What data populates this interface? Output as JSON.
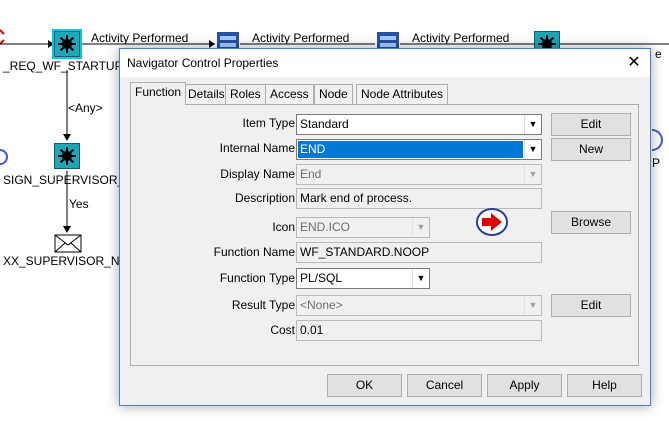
{
  "background": {
    "edge_labels": [
      "Activity Performed",
      "Activity Performed",
      "Activity Performed"
    ],
    "node_label_1": "_REQ_WF_STARTUP_V",
    "any_label": "<Any>",
    "node_label_2": "SIGN_SUPERVISOR_RO",
    "yes_label": "Yes",
    "node_label_3": "XX_SUPERVISOR_NOT",
    "cut_label_right": "e",
    "cut_label_p": "P"
  },
  "dialog": {
    "title": "Navigator Control Properties",
    "close_glyph": "✕",
    "tabs": [
      "Function",
      "Details",
      "Roles",
      "Access",
      "Node",
      "Node Attributes"
    ],
    "active_tab": "Function",
    "fields": {
      "item_type": {
        "label": "Item Type",
        "value": "Standard"
      },
      "internal_name": {
        "label": "Internal Name",
        "value": "END"
      },
      "display_name": {
        "label": "Display Name",
        "value": "End"
      },
      "description": {
        "label": "Description",
        "value": "Mark end of process."
      },
      "icon": {
        "label": "Icon",
        "value": "END.ICO"
      },
      "function_name": {
        "label": "Function Name",
        "value": "WF_STANDARD.NOOP"
      },
      "function_type": {
        "label": "Function Type",
        "value": "PL/SQL"
      },
      "result_type": {
        "label": "Result Type",
        "value": "<None>"
      },
      "cost": {
        "label": "Cost",
        "value": "0.01"
      }
    },
    "side_buttons": {
      "edit_item_type": "Edit",
      "new": "New",
      "browse": "Browse",
      "edit_result_type": "Edit"
    },
    "footer_buttons": {
      "ok": "OK",
      "cancel": "Cancel",
      "apply": "Apply",
      "help": "Help"
    },
    "icon_preview": "end-arrow-icon"
  },
  "colors": {
    "selection": "#0078d7",
    "node_fill": "#1fa6b8",
    "dialog_border": "#4a7fc0"
  }
}
